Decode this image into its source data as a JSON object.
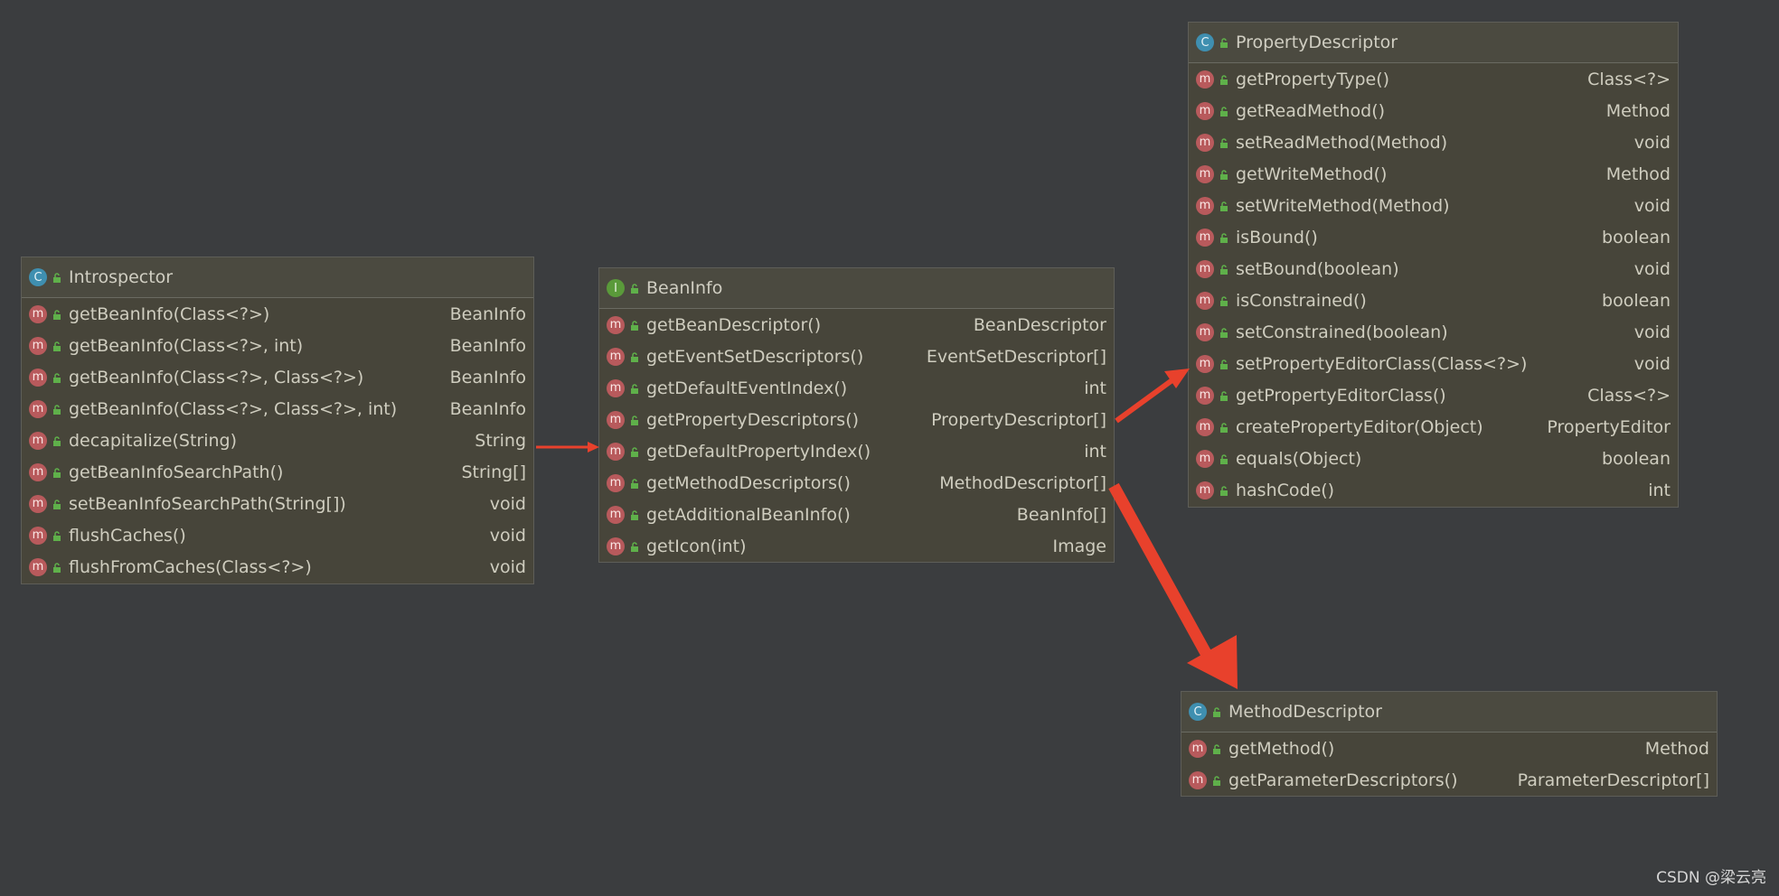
{
  "boxes": {
    "introspector": {
      "kind": "C",
      "name": "Introspector",
      "methods": [
        {
          "name": "getBeanInfo(Class<?>)",
          "type": "BeanInfo"
        },
        {
          "name": "getBeanInfo(Class<?>, int)",
          "type": "BeanInfo"
        },
        {
          "name": "getBeanInfo(Class<?>, Class<?>)",
          "type": "BeanInfo"
        },
        {
          "name": "getBeanInfo(Class<?>, Class<?>, int)",
          "type": "BeanInfo"
        },
        {
          "name": "decapitalize(String)",
          "type": "String"
        },
        {
          "name": "getBeanInfoSearchPath()",
          "type": "String[]"
        },
        {
          "name": "setBeanInfoSearchPath(String[])",
          "type": "void"
        },
        {
          "name": "flushCaches()",
          "type": "void"
        },
        {
          "name": "flushFromCaches(Class<?>)",
          "type": "void"
        }
      ]
    },
    "beaninfo": {
      "kind": "I",
      "name": "BeanInfo",
      "methods": [
        {
          "name": "getBeanDescriptor()",
          "type": "BeanDescriptor"
        },
        {
          "name": "getEventSetDescriptors()",
          "type": "EventSetDescriptor[]"
        },
        {
          "name": "getDefaultEventIndex()",
          "type": "int"
        },
        {
          "name": "getPropertyDescriptors()",
          "type": "PropertyDescriptor[]"
        },
        {
          "name": "getDefaultPropertyIndex()",
          "type": "int"
        },
        {
          "name": "getMethodDescriptors()",
          "type": "MethodDescriptor[]"
        },
        {
          "name": "getAdditionalBeanInfo()",
          "type": "BeanInfo[]"
        },
        {
          "name": "getIcon(int)",
          "type": "Image"
        }
      ]
    },
    "propertydescriptor": {
      "kind": "C",
      "name": "PropertyDescriptor",
      "methods": [
        {
          "name": "getPropertyType()",
          "type": "Class<?>"
        },
        {
          "name": "getReadMethod()",
          "type": "Method"
        },
        {
          "name": "setReadMethod(Method)",
          "type": "void"
        },
        {
          "name": "getWriteMethod()",
          "type": "Method"
        },
        {
          "name": "setWriteMethod(Method)",
          "type": "void"
        },
        {
          "name": "isBound()",
          "type": "boolean"
        },
        {
          "name": "setBound(boolean)",
          "type": "void"
        },
        {
          "name": "isConstrained()",
          "type": "boolean"
        },
        {
          "name": "setConstrained(boolean)",
          "type": "void"
        },
        {
          "name": "setPropertyEditorClass(Class<?>)",
          "type": "void"
        },
        {
          "name": "getPropertyEditorClass()",
          "type": "Class<?>"
        },
        {
          "name": "createPropertyEditor(Object)",
          "type": "PropertyEditor"
        },
        {
          "name": "equals(Object)",
          "type": "boolean"
        },
        {
          "name": "hashCode()",
          "type": "int"
        }
      ]
    },
    "methoddescriptor": {
      "kind": "C",
      "name": "MethodDescriptor",
      "methods": [
        {
          "name": "getMethod()",
          "type": "Method"
        },
        {
          "name": "getParameterDescriptors()",
          "type": "ParameterDescriptor[]"
        }
      ]
    }
  },
  "method_icon_letter": "m",
  "colors": {
    "background": "#3b3d3f",
    "box_fill": "#47453a",
    "arrow": "#e8412c",
    "class_icon": "#3f8fb0",
    "interface_icon": "#5a9a3a",
    "method_icon": "#b85a5c",
    "lock_icon": "#5fb04a"
  },
  "watermark": "CSDN @梁云亮"
}
